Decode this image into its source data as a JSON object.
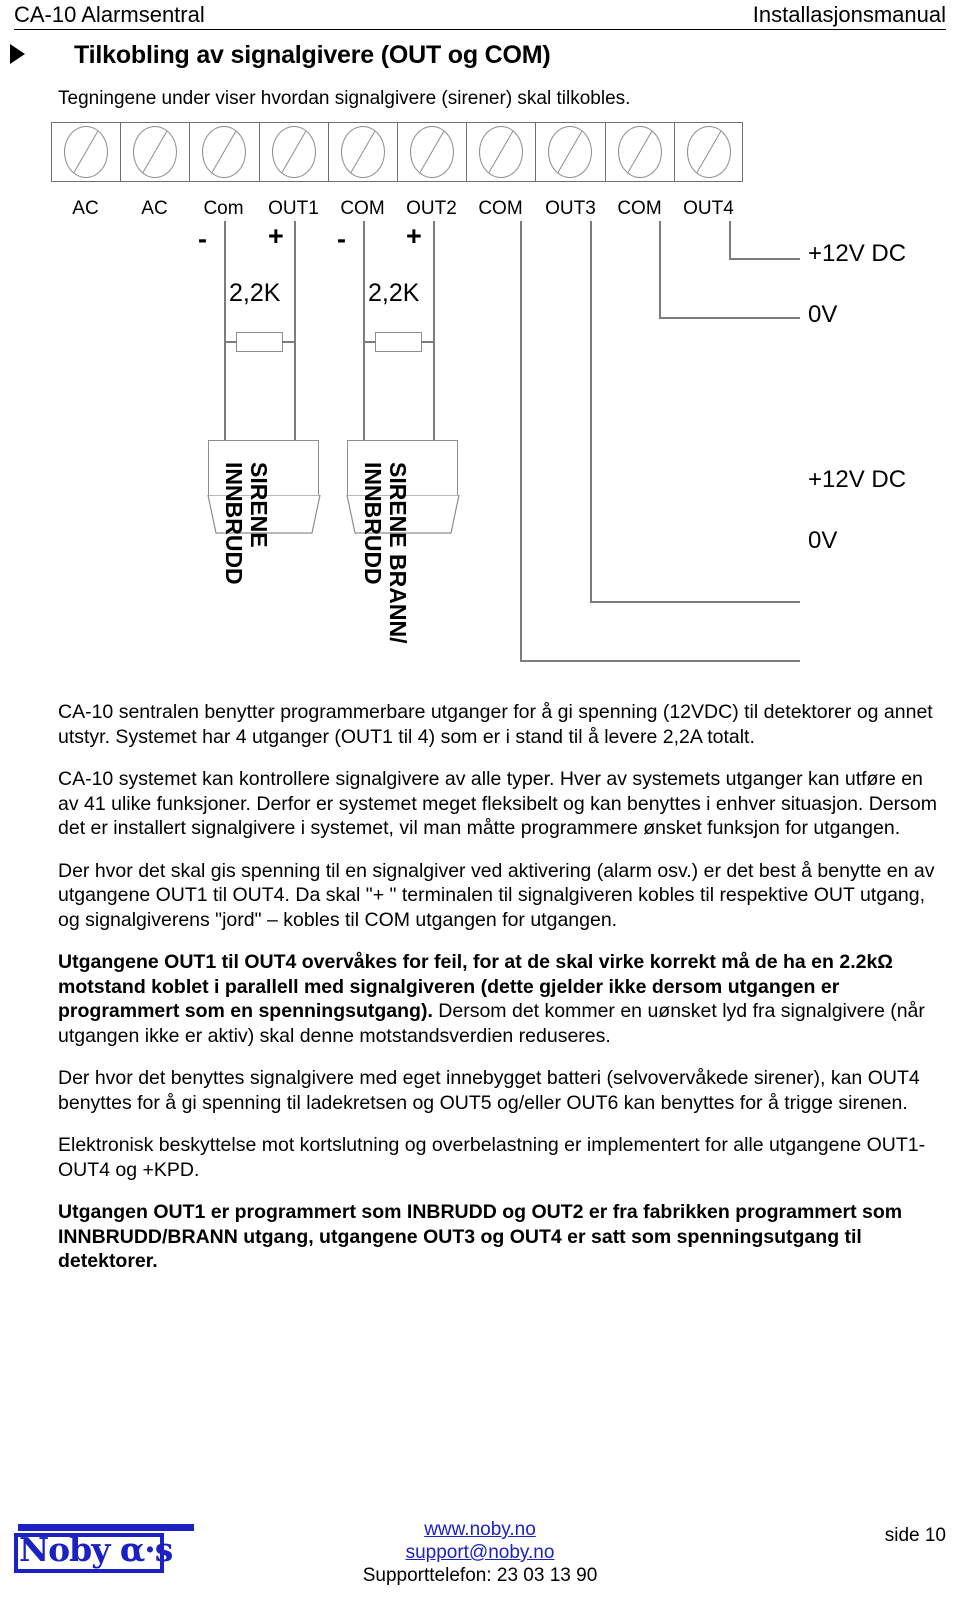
{
  "header": {
    "left": "CA-10 Alarmsentral",
    "right": "Installasjonsmanual"
  },
  "title": {
    "bullet_icon": "triangle-right-icon",
    "text": "Tilkobling av signalgivere (OUT og COM)"
  },
  "intro": "Tegningene under viser hvordan signalgivere (sirener) skal tilkobles.",
  "diagram": {
    "terminals": [
      {
        "label": "AC"
      },
      {
        "label": "AC"
      },
      {
        "label": "Com"
      },
      {
        "label": "OUT1"
      },
      {
        "label": "COM"
      },
      {
        "label": "OUT2"
      },
      {
        "label": "COM"
      },
      {
        "label": "OUT3"
      },
      {
        "label": "COM"
      },
      {
        "label": "OUT4"
      }
    ],
    "signs": [
      "-",
      "+",
      "-",
      "+"
    ],
    "resistors": [
      "2,2K",
      "2,2K"
    ],
    "siren_labels": [
      "SIRENE\nINNBRUDD",
      "SIRENE BRANN/\nINNBRUDD"
    ],
    "siren_label_1_line1": "SIRENE",
    "siren_label_1_line2": "INNBRUDD",
    "siren_label_2_line1": "SIRENE BRANN/",
    "siren_label_2_line2": "INNBRUDD",
    "power_top": {
      "plus": "+12V DC",
      "zero": "0V"
    },
    "power_bottom": {
      "plus": "+12V DC",
      "zero": "0V"
    }
  },
  "body": {
    "p1": "CA-10 sentralen benytter programmerbare utganger for å gi spenning (12VDC) til detektorer og annet utstyr. Systemet har 4 utganger (OUT1 til 4) som er i stand til å levere 2,2A totalt.",
    "p2": "CA-10 systemet kan kontrollere signalgivere av alle typer. Hver av systemets utganger kan utføre en av 41 ulike funksjoner. Derfor er systemet meget fleksibelt og kan benyttes i enhver situasjon. Dersom det er installert signalgivere i systemet, vil man måtte programmere ønsket funksjon for utgangen.",
    "p3": "Der hvor det skal gis spenning til en signalgiver ved aktivering (alarm osv.) er det best å benytte en av utgangene OUT1 til OUT4. Da skal \"+ \" terminalen til signalgiveren kobles til respektive OUT utgang, og signalgiverens \"jord\" – kobles til COM utgangen for utgangen.",
    "p4_bold": "Utgangene OUT1 til OUT4 overvåkes for feil, for at de skal virke korrekt må de ha en 2.2kΩ motstand koblet i parallell med signalgiveren (dette gjelder ikke dersom utgangen er programmert som en spenningsutgang).",
    "p4_rest": " Dersom det kommer en uønsket lyd fra signalgivere (når utgangen ikke er aktiv) skal denne motstandsverdien reduseres.",
    "p5": "Der hvor det benyttes signalgivere med eget innebygget batteri (selvovervåkede sirener), kan OUT4 benyttes for å gi spenning til ladekretsen og OUT5 og/eller OUT6 kan benyttes for å trigge sirenen.",
    "p6": "Elektronisk beskyttelse mot kortslutning og overbelastning er implementert for alle utgangene OUT1-OUT4 og +KPD.",
    "p7_bold": "Utgangen OUT1 er programmert som INBRUDD og OUT2 er fra fabrikken programmert som INNBRUDD/BRANN utgang, utgangene OUT3 og OUT4 er satt som spenningsutgang til detektorer."
  },
  "footer": {
    "logo_text": "Noby α·s",
    "website": "www.noby.no",
    "email": "support@noby.no",
    "phone": "Supporttelefon: 23 03 13 90",
    "page": "side 10",
    "link_color": "#1c21c4"
  }
}
